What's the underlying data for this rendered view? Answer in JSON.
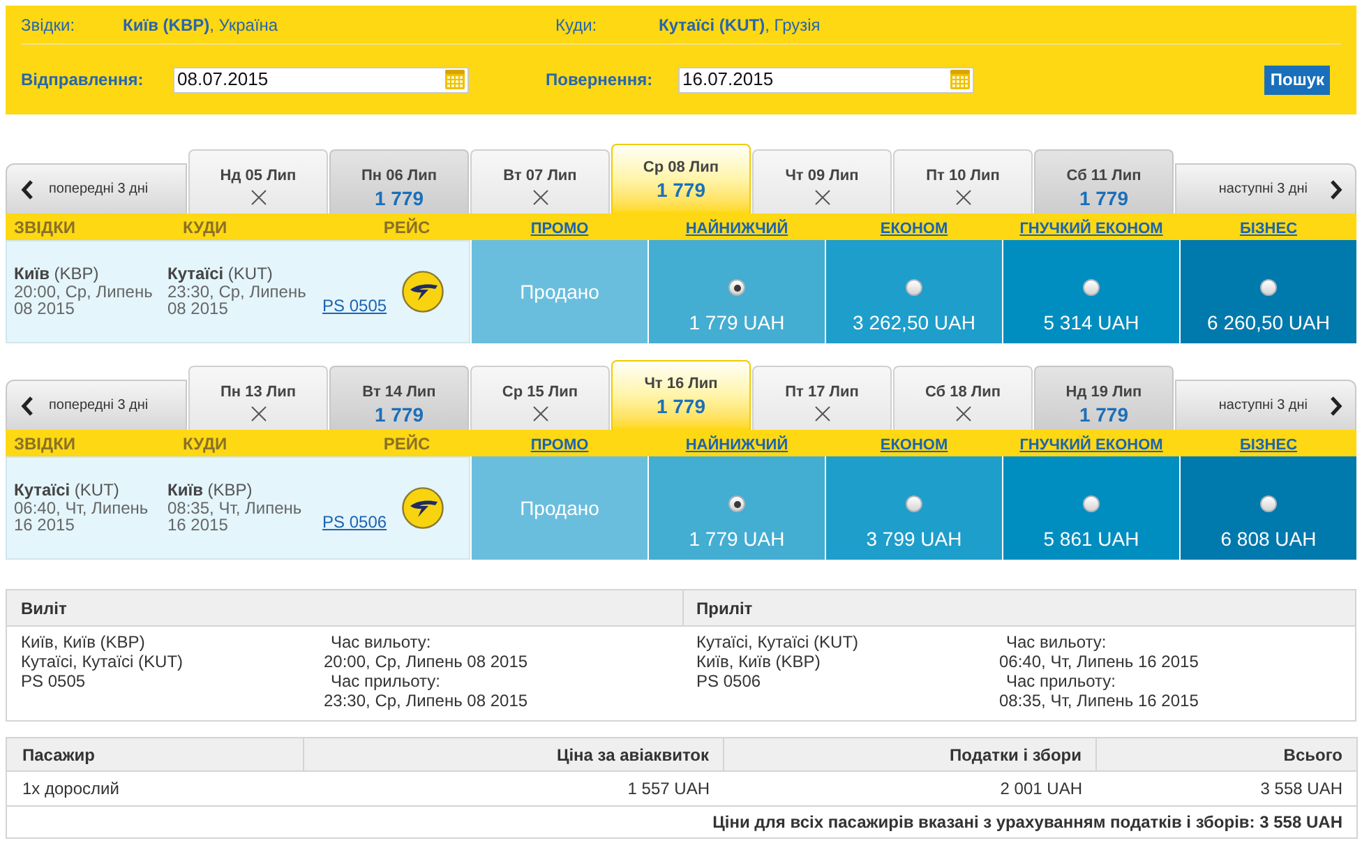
{
  "search_form": {
    "from": {
      "label": "Звідки:",
      "value": "**Київ (KBP)**, Україна"
    },
    "to": {
      "label": "Куди:",
      "value": "**Кутаїсі (KUT)**, Грузія"
    },
    "departure": {
      "label": "Відправлення:",
      "value": "08.07.2015"
    },
    "return": {
      "label": "Повернення:",
      "value": "16.07.2015"
    },
    "search_button": "Пошук"
  },
  "legs": [
    {
      "prev_button": "попередні 3 дні",
      "next_button": "наступні 3 дні",
      "date_tabs": [
        {
          "label": "Нд 05 Лип",
          "available": false,
          "selected": false
        },
        {
          "label": "Пн 06 Лип",
          "available": true,
          "price": "1 779",
          "selected": false
        },
        {
          "label": "Вт 07 Лип",
          "available": false,
          "selected": false
        },
        {
          "label": "Ср 08 Лип",
          "available": true,
          "price": "1 779",
          "selected": true
        },
        {
          "label": "Чт 09 Лип",
          "available": false,
          "selected": false
        },
        {
          "label": "Пт 10 Лип",
          "available": false,
          "selected": false
        },
        {
          "label": "Сб 11 Лип",
          "available": true,
          "price": "1 779",
          "selected": false
        }
      ],
      "columns": [
        "ЗВІДКИ",
        "КУДИ",
        "РЕЙС"
      ],
      "flight": {
        "origin": "**Київ** (KBP)",
        "departure_time": "20:00, Ср, Липень 08 2015",
        "destination": "**Кутаїсі** (KUT)",
        "arrival_time": "23:30, Ср, Липень 08 2015",
        "flight_number": "PS 0505"
      },
      "fares": [
        {
          "heading": "ПРОМО",
          "kind": "sold_out",
          "status": "Продано"
        },
        {
          "heading": "НАЙНИЖЧИЙ",
          "kind": "price",
          "selected": true,
          "price": "1 779 UAH"
        },
        {
          "heading": "ЕКОНОМ",
          "kind": "price",
          "selected": false,
          "price": "3 262,50 UAH"
        },
        {
          "heading": "ГНУЧКИЙ ЕКОНОМ",
          "kind": "price",
          "selected": false,
          "price": "5 314 UAH"
        },
        {
          "heading": "БІЗНЕС",
          "kind": "price",
          "selected": false,
          "price": "6 260,50 UAH"
        }
      ]
    },
    {
      "prev_button": "попередні 3 дні",
      "next_button": "наступні 3 дні",
      "date_tabs": [
        {
          "label": "Пн 13 Лип",
          "available": false,
          "selected": false
        },
        {
          "label": "Вт 14 Лип",
          "available": true,
          "price": "1 779",
          "selected": false
        },
        {
          "label": "Ср 15 Лип",
          "available": false,
          "selected": false
        },
        {
          "label": "Чт 16 Лип",
          "available": true,
          "price": "1 779",
          "selected": true
        },
        {
          "label": "Пт 17 Лип",
          "available": false,
          "selected": false
        },
        {
          "label": "Сб 18 Лип",
          "available": false,
          "selected": false
        },
        {
          "label": "Нд 19 Лип",
          "available": true,
          "price": "1 779",
          "selected": false
        }
      ],
      "columns": [
        "ЗВІДКИ",
        "КУДИ",
        "РЕЙС"
      ],
      "flight": {
        "origin": "**Кутаїсі** (KUT)",
        "departure_time": "06:40, Чт, Липень 16 2015",
        "destination": "**Київ** (KBP)",
        "arrival_time": "08:35, Чт, Липень 16 2015",
        "flight_number": "PS 0506"
      },
      "fares": [
        {
          "heading": "ПРОМО",
          "kind": "sold_out",
          "status": "Продано"
        },
        {
          "heading": "НАЙНИЖЧИЙ",
          "kind": "price",
          "selected": true,
          "price": "1 779 UAH"
        },
        {
          "heading": "ЕКОНОМ",
          "kind": "price",
          "selected": false,
          "price": "3 799 UAH"
        },
        {
          "heading": "ГНУЧКИЙ ЕКОНОМ",
          "kind": "price",
          "selected": false,
          "price": "5 861 UAH"
        },
        {
          "heading": "БІЗНЕС",
          "kind": "price",
          "selected": false,
          "price": "6 808 UAH"
        }
      ]
    }
  ],
  "itinerary": [
    {
      "heading": "Виліт",
      "route": [
        "Київ, Київ (KBP)",
        "Кутаїсі, Кутаїсі (KUT)",
        "PS 0505"
      ],
      "departure_label": "Час вильоту:",
      "departure_time": "20:00, Ср, Липень 08 2015",
      "arrival_label": "Час прильоту:",
      "arrival_time": "23:30, Ср, Липень 08 2015"
    },
    {
      "heading": "Приліт",
      "route": [
        "Кутаїсі, Кутаїсі (KUT)",
        "Київ, Київ (KBP)",
        "PS 0506"
      ],
      "departure_label": "Час вильоту:",
      "departure_time": "06:40, Чт, Липень 16 2015",
      "arrival_label": "Час прильоту:",
      "arrival_time": "08:35, Чт, Липень 16 2015"
    }
  ],
  "price_table": {
    "columns": [
      "Пасажир",
      "Ціна за авіаквиток",
      "Податки і збори",
      "Всього"
    ],
    "rows": [
      [
        "1x дорослий",
        "1 557 UAH",
        "2 001 UAH",
        "3 558 UAH"
      ]
    ],
    "total_note": "Ціни для всіх пасажирів вказані з урахуванням податків і зборів: 3 558 UAH"
  }
}
